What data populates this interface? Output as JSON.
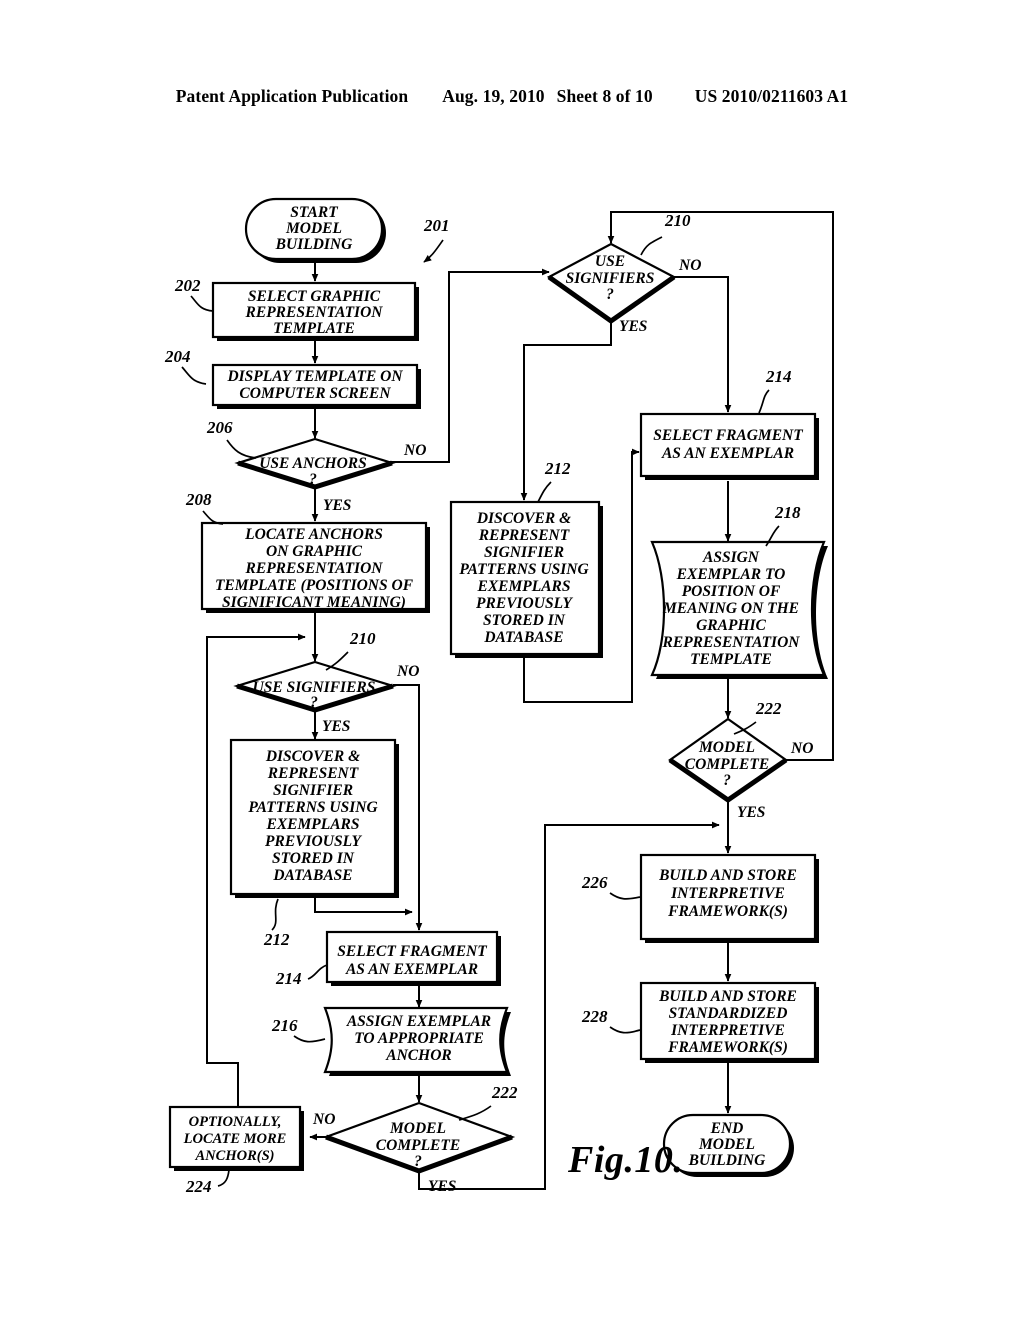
{
  "header": {
    "publication": "Patent Application Publication",
    "date": "Aug. 19, 2010",
    "sheet": "Sheet 8 of 10",
    "docnum": "US 2010/0211603 A1"
  },
  "figure": {
    "label": "Fig.10.",
    "overall_ref": "201"
  },
  "nodes": {
    "start": {
      "ref": "",
      "text_lines": [
        "START",
        "MODEL",
        "BUILDING"
      ],
      "shape": "terminator"
    },
    "n202": {
      "ref": "202",
      "text_lines": [
        "SELECT GRAPHIC",
        "REPRESENTATION",
        "TEMPLATE"
      ],
      "shape": "process"
    },
    "n204": {
      "ref": "204",
      "text_lines": [
        "DISPLAY TEMPLATE ON",
        "COMPUTER SCREEN"
      ],
      "shape": "process"
    },
    "n206": {
      "ref": "206",
      "text_lines": [
        "USE ANCHORS",
        "?"
      ],
      "shape": "decision",
      "yes": "YES",
      "no": "NO"
    },
    "n208": {
      "ref": "208",
      "text_lines": [
        "LOCATE ANCHORS",
        "ON GRAPHIC",
        "REPRESENTATION",
        "TEMPLATE (POSITIONS OF",
        "SIGNIFICANT MEANING)"
      ],
      "shape": "process"
    },
    "n210_left": {
      "ref": "210",
      "text_lines": [
        "USE SIGNIFIERS",
        "?"
      ],
      "shape": "decision",
      "yes": "YES",
      "no": "NO"
    },
    "n210_top": {
      "ref": "210",
      "text_lines": [
        "USE",
        "SIGNIFIERS",
        "?"
      ],
      "shape": "decision",
      "yes": "YES",
      "no": "NO"
    },
    "n212_left": {
      "ref": "212",
      "text_lines": [
        "DISCOVER &",
        "REPRESENT",
        "SIGNIFIER",
        "PATTERNS USING",
        "EXEMPLARS",
        "PREVIOUSLY",
        "STORED IN",
        "DATABASE"
      ],
      "shape": "process"
    },
    "n212_mid": {
      "ref": "212",
      "text_lines": [
        "DISCOVER &",
        "REPRESENT",
        "SIGNIFIER",
        "PATTERNS USING",
        "EXEMPLARS",
        "PREVIOUSLY",
        "STORED IN",
        "DATABASE"
      ],
      "shape": "process"
    },
    "n214_left": {
      "ref": "214",
      "text_lines": [
        "SELECT FRAGMENT",
        "AS AN EXEMPLAR"
      ],
      "shape": "process"
    },
    "n214_right": {
      "ref": "214",
      "text_lines": [
        "SELECT FRAGMENT",
        "AS AN EXEMPLAR"
      ],
      "shape": "process"
    },
    "n216": {
      "ref": "216",
      "text_lines": [
        "ASSIGN EXEMPLAR",
        "TO APPROPRIATE",
        "ANCHOR"
      ],
      "shape": "document"
    },
    "n218": {
      "ref": "218",
      "text_lines": [
        "ASSIGN",
        "EXEMPLAR TO",
        "POSITION OF",
        "MEANING ON THE",
        "GRAPHIC",
        "REPRESENTATION",
        "TEMPLATE"
      ],
      "shape": "document"
    },
    "n222_left": {
      "ref": "222",
      "text_lines": [
        "MODEL",
        "COMPLETE",
        "?"
      ],
      "shape": "decision",
      "yes": "YES",
      "no": "NO"
    },
    "n222_right": {
      "ref": "222",
      "text_lines": [
        "MODEL",
        "COMPLETE",
        "?"
      ],
      "shape": "decision",
      "yes": "YES",
      "no": "NO"
    },
    "n224": {
      "ref": "224",
      "text_lines": [
        "OPTIONALLY,",
        "LOCATE MORE",
        "ANCHOR(S)"
      ],
      "shape": "process"
    },
    "n226": {
      "ref": "226",
      "text_lines": [
        "BUILD AND STORE",
        "INTERPRETIVE",
        "FRAMEWORK(S)"
      ],
      "shape": "process"
    },
    "n228": {
      "ref": "228",
      "text_lines": [
        "BUILD AND STORE",
        "STANDARDIZED",
        "INTERPRETIVE",
        "FRAMEWORK(S)"
      ],
      "shape": "process"
    },
    "end": {
      "ref": "",
      "text_lines": [
        "END",
        "MODEL",
        "BUILDING"
      ],
      "shape": "terminator"
    }
  },
  "colors": {
    "ink": "#000000",
    "paper": "#ffffff"
  }
}
